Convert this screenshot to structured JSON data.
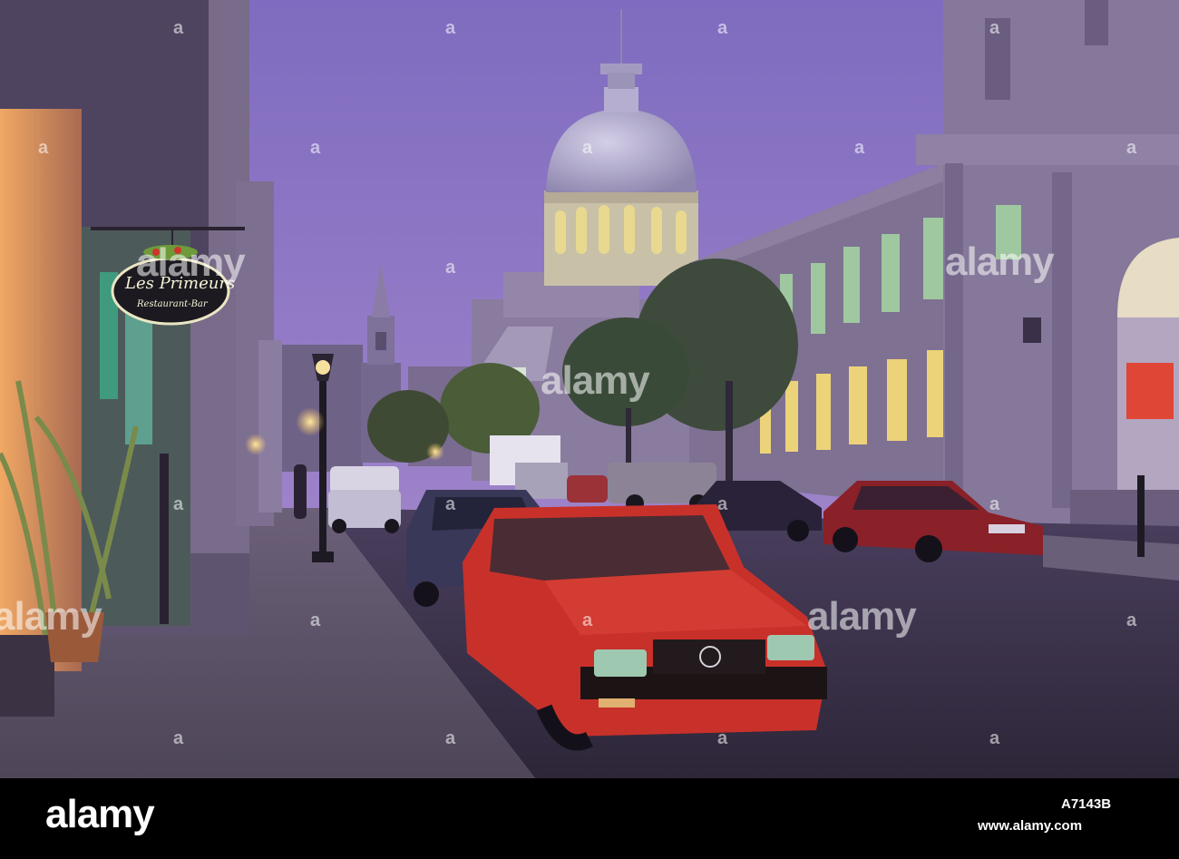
{
  "watermark": {
    "main": "alamy",
    "small": "a"
  },
  "sign": {
    "name": "Les Primeurs",
    "subtitle": "Restaurant-Bar"
  },
  "footer": {
    "logo": "alamy",
    "image_id": "A7143B",
    "site": "www.alamy.com"
  },
  "colors": {
    "sky": "#8a74c4",
    "dome": "#b8b0d8",
    "red_car": "#c8312a",
    "building": "#7d6f8f"
  }
}
